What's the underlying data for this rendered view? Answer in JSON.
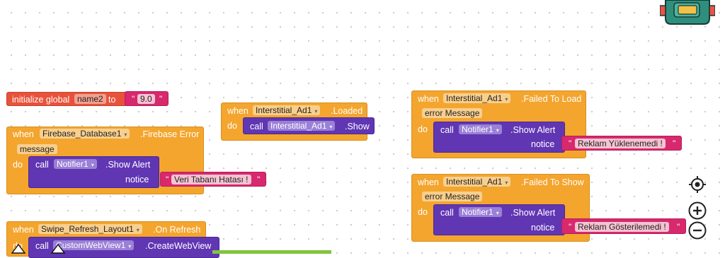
{
  "global_init": {
    "initialize_label": "initialize global",
    "var_name": "name2",
    "to_label": "to",
    "value": "9.0"
  },
  "firebase_error": {
    "when": "when",
    "component": "Firebase_Database1",
    "event": ".Firebase Error",
    "param": "message",
    "do": "do",
    "call": "call",
    "target": "Notifier1",
    "method": ".Show Alert",
    "arg_label": "notice",
    "text": "Veri Tabanı Hatası !"
  },
  "interstitial_loaded": {
    "when": "when",
    "component": "Interstitial_Ad1",
    "event": ".Loaded",
    "do": "do",
    "call": "call",
    "target": "Interstitial_Ad1",
    "method": ".Show"
  },
  "failed_to_load": {
    "when": "when",
    "component": "Interstitial_Ad1",
    "event": ".Failed To Load",
    "param": "error Message",
    "do": "do",
    "call": "call",
    "target": "Notifier1",
    "method": ".Show Alert",
    "arg_label": "notice",
    "text": "Reklam Yüklenemedi !"
  },
  "failed_to_show": {
    "when": "when",
    "component": "Interstitial_Ad1",
    "event": ".Failed To Show",
    "param": "error Message",
    "do": "do",
    "call": "call",
    "target": "Notifier1",
    "method": ".Show Alert",
    "arg_label": "notice",
    "text": "Reklam Gösterilemedi !"
  },
  "swipe_refresh": {
    "when": "when",
    "component": "Swipe_Refresh_Layout1",
    "event": ".On Refresh",
    "do": "do",
    "call": "call",
    "target": "CustomWebView1",
    "method": ".CreateWebView"
  },
  "quote_char": "\"",
  "dropdown_glyph": "▾",
  "colors": {
    "event_block": "#f4a52e",
    "method_block": "#6036b3",
    "global_block": "#e8523a",
    "text_block": "#d8286e",
    "math_block": "#82c43e"
  },
  "icons": {
    "backpack": "backpack-icon",
    "center": "center-target-icon",
    "zoom_in": "zoom-in-icon",
    "zoom_out": "zoom-out-icon",
    "warnings": "warning-triangle-icon"
  }
}
